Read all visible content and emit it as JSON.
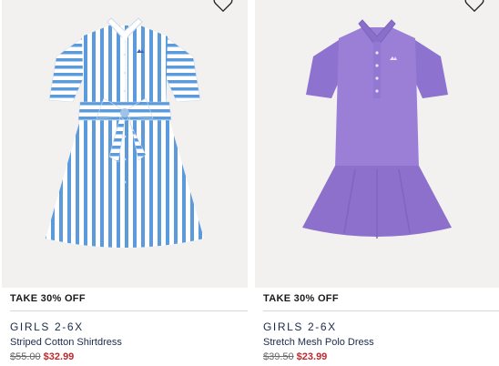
{
  "products": [
    {
      "promo": "TAKE 30% OFF",
      "category": "GIRLS 2-6X",
      "name": "Striped Cotton Shirtdress",
      "price_original": "$55.00",
      "price_sale": "$32.99",
      "wishlist_icon": "heart-outline-icon"
    },
    {
      "promo": "TAKE 30% OFF",
      "category": "GIRLS 2-6X",
      "name": "Stretch Mesh Polo Dress",
      "price_original": "$39.50",
      "price_sale": "$23.99",
      "wishlist_icon": "heart-outline-icon"
    }
  ],
  "colors": {
    "sale_price": "#c0282d",
    "text_navy": "#1b2a4a",
    "image_bg": "#f2f1f0",
    "stripe_blue": "#5c9bdb",
    "polo_purple": "#9b7fd6"
  }
}
